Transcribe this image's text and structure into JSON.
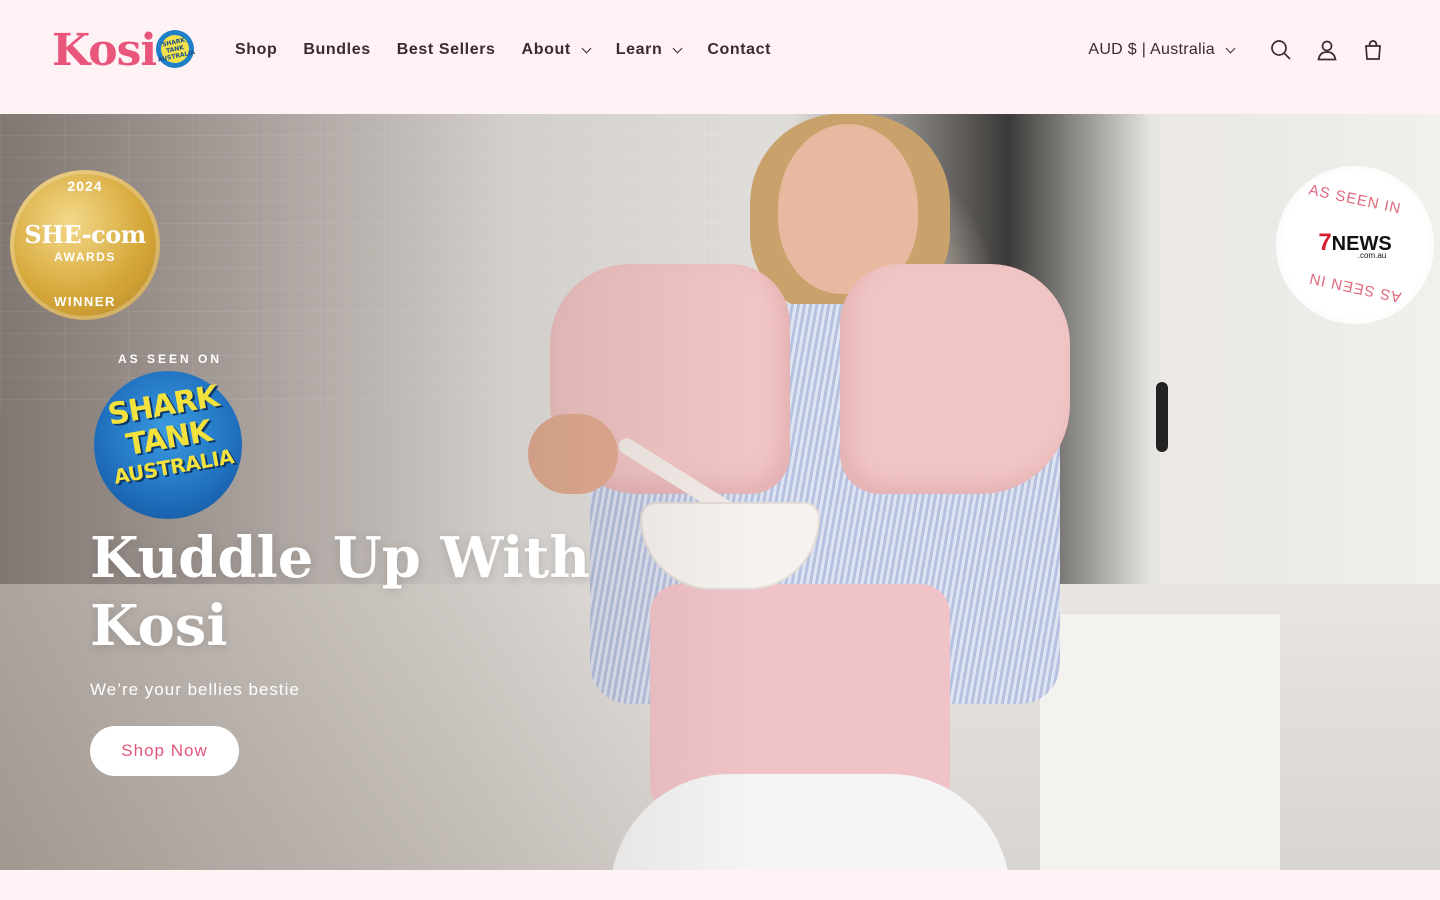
{
  "brand": {
    "name": "Kosi",
    "logo_badge": "SHARK TANK AUSTRALIA"
  },
  "nav": {
    "items": [
      {
        "label": "Shop",
        "dropdown": false
      },
      {
        "label": "Bundles",
        "dropdown": false
      },
      {
        "label": "Best Sellers",
        "dropdown": false
      },
      {
        "label": "About",
        "dropdown": true
      },
      {
        "label": "Learn",
        "dropdown": true
      },
      {
        "label": "Contact",
        "dropdown": false
      }
    ]
  },
  "header_tools": {
    "currency": "AUD $ | Australia",
    "icons": [
      "search-icon",
      "account-icon",
      "cart-icon"
    ]
  },
  "hero": {
    "award_badge": {
      "year": "2024",
      "title": "SHE-com",
      "subtitle": "AWARDS",
      "footer": "WINNER"
    },
    "press_badge": {
      "top_text": "AS SEEN IN",
      "logo": "NEWS",
      "logo_number": "7",
      "logo_sub": ".com.au",
      "bottom_text": "AS SEEN IN"
    },
    "as_seen_on": "AS SEEN ON",
    "shark_tank": {
      "line1": "SHARK",
      "line2": "TANK",
      "line3": "AUSTRALIA"
    },
    "title_line1": "Kuddle Up With",
    "title_line2": "Kosi",
    "subtitle": "We’re your bellies bestie",
    "cta_label": "Shop Now"
  },
  "colors": {
    "header_bg": "#fff2f5",
    "brand_pink": "#e9567c",
    "nav_text": "#3b2a2e",
    "cta_text": "#e2567a"
  }
}
